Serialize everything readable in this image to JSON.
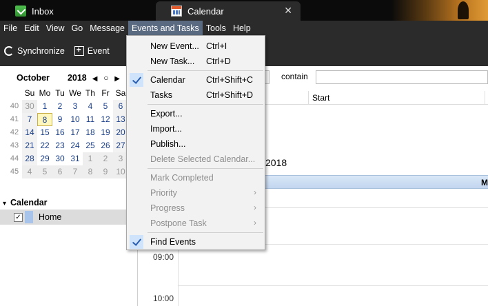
{
  "tabs": [
    {
      "label": "Inbox",
      "icon": "inbox-icon"
    },
    {
      "label": "Calendar",
      "icon": "calendar-icon",
      "close": "✕"
    }
  ],
  "menubar": [
    "File",
    "Edit",
    "View",
    "Go",
    "Message",
    "Events and Tasks",
    "Tools",
    "Help"
  ],
  "toolbar": {
    "synchronize": "Synchronize",
    "event": "Event"
  },
  "minical": {
    "month": "October",
    "year": "2018",
    "dow": [
      "Su",
      "Mo",
      "Tu",
      "We",
      "Th",
      "Fr",
      "Sa"
    ],
    "weeks": [
      "40",
      "41",
      "42",
      "43",
      "44",
      "45"
    ],
    "rows": [
      [
        "30",
        "1",
        "2",
        "3",
        "4",
        "5",
        "6"
      ],
      [
        "7",
        "8",
        "9",
        "10",
        "11",
        "12",
        "13"
      ],
      [
        "14",
        "15",
        "16",
        "17",
        "18",
        "19",
        "20"
      ],
      [
        "21",
        "22",
        "23",
        "24",
        "25",
        "26",
        "27"
      ],
      [
        "28",
        "29",
        "30",
        "31",
        "1",
        "2",
        "3"
      ],
      [
        "4",
        "5",
        "6",
        "7",
        "8",
        "9",
        "10"
      ]
    ],
    "today": "8"
  },
  "calendars": {
    "title": "Calendar",
    "items": [
      {
        "name": "Home",
        "checked": true,
        "color": "#a9c4ea"
      }
    ]
  },
  "main": {
    "filter_contain": "contain",
    "columns": [
      "Start"
    ],
    "date_fragment": "2018",
    "day_fragment": "M",
    "times": [
      "09:00",
      "10:00"
    ]
  },
  "dropdown": {
    "items": [
      {
        "label": "New Event...",
        "shortcut": "Ctrl+I"
      },
      {
        "label": "New Task...",
        "shortcut": "Ctrl+D"
      },
      {
        "label": "Calendar",
        "shortcut": "Ctrl+Shift+C",
        "checked": true
      },
      {
        "label": "Tasks",
        "shortcut": "Ctrl+Shift+D"
      },
      {
        "label": "Export..."
      },
      {
        "label": "Import..."
      },
      {
        "label": "Publish..."
      },
      {
        "label": "Delete Selected Calendar...",
        "disabled": true
      },
      {
        "label": "Mark Completed",
        "disabled": true
      },
      {
        "label": "Priority",
        "disabled": true,
        "submenu": "›"
      },
      {
        "label": "Progress",
        "disabled": true,
        "submenu": "›"
      },
      {
        "label": "Postpone Task",
        "disabled": true,
        "submenu": "›"
      },
      {
        "label": "Find Events",
        "checked": true
      }
    ]
  }
}
